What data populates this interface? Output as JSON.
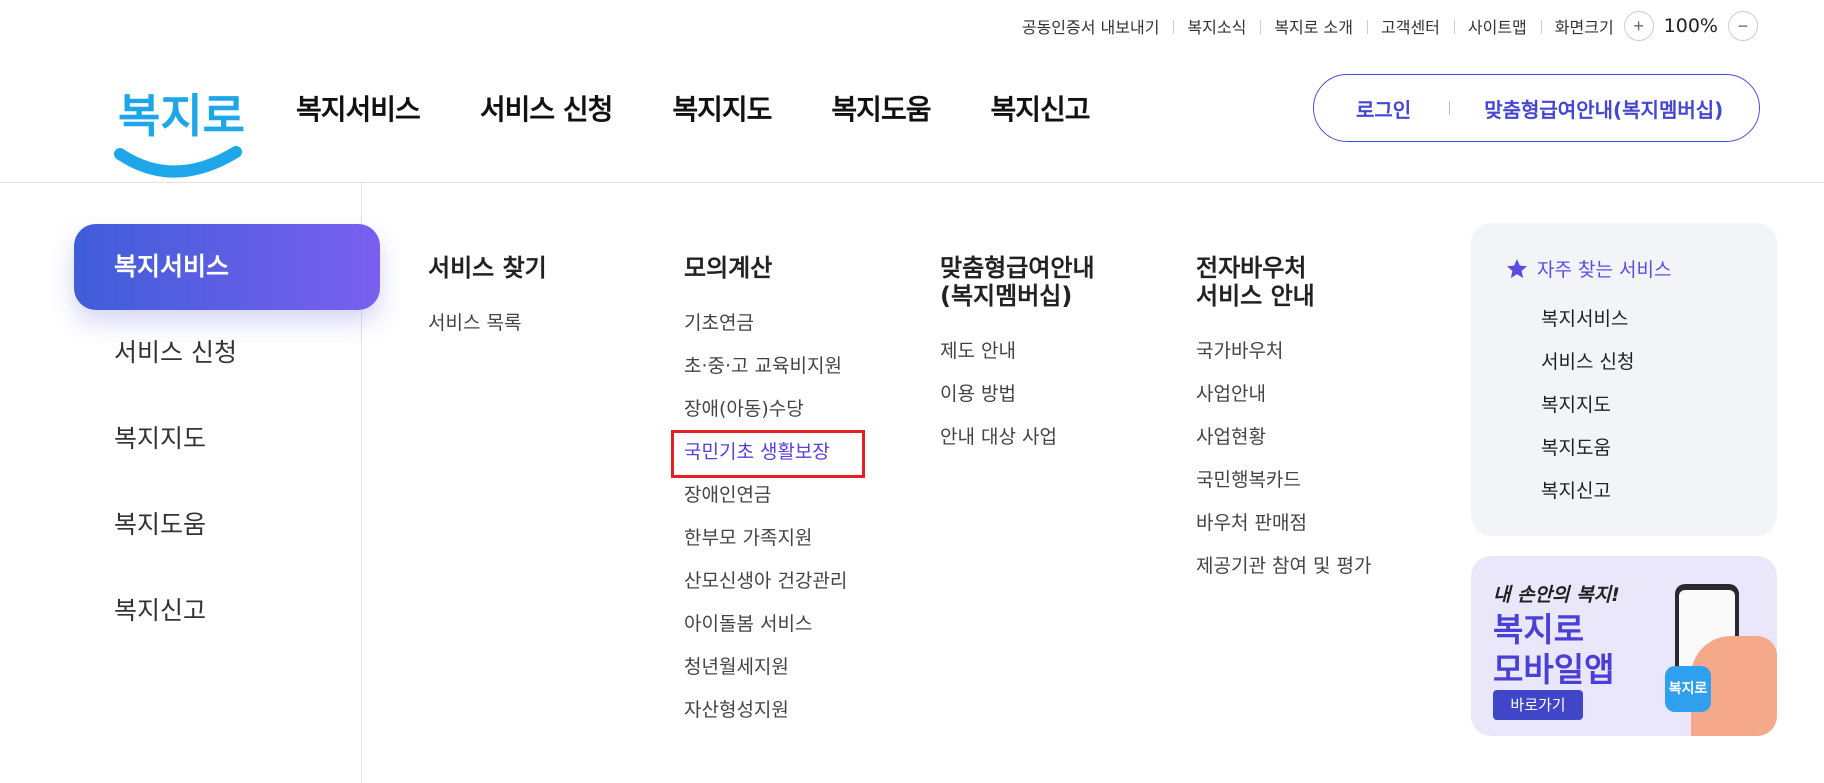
{
  "utility": {
    "links": [
      "공동인증서 내보내기",
      "복지소식",
      "복지로 소개",
      "고객센터",
      "사이트맵"
    ],
    "zoom_label": "화면크기",
    "zoom_in": "+",
    "zoom_value": "100%",
    "zoom_out": "−"
  },
  "logo": {
    "text": "복지로"
  },
  "gnb": [
    "복지서비스",
    "서비스 신청",
    "복지지도",
    "복지도움",
    "복지신고"
  ],
  "top_buttons": {
    "login": "로그인",
    "membership": "맞춤형급여안내(복지멤버십)"
  },
  "side_menu": {
    "items": [
      "복지서비스",
      "서비스 신청",
      "복지지도",
      "복지도움",
      "복지신고"
    ],
    "active_index": 0
  },
  "submenu": [
    {
      "title": "서비스 찾기",
      "items": [
        "서비스 목록"
      ]
    },
    {
      "title": "모의계산",
      "items": [
        "기초연금",
        "초·중·고 교육비지원",
        "장애(아동)수당",
        "국민기초 생활보장",
        "장애인연금",
        "한부모 가족지원",
        "산모신생아 건강관리",
        "아이돌봄 서비스",
        "청년월세지원",
        "자산형성지원"
      ],
      "highlighted_index": 3
    },
    {
      "title": "맞춤형급여안내\n(복지멤버십)",
      "items": [
        "제도 안내",
        "이용 방법",
        "안내 대상 사업"
      ]
    },
    {
      "title": "전자바우처\n서비스 안내",
      "items": [
        "국가바우처",
        "사업안내",
        "사업현황",
        "국민행복카드",
        "바우처 판매점",
        "제공기관 참여 및 평가"
      ]
    }
  ],
  "favorites": {
    "title": "자주 찾는 서비스",
    "icon": "star-icon",
    "items": [
      "복지서비스",
      "서비스 신청",
      "복지지도",
      "복지도움",
      "복지신고"
    ]
  },
  "banner": {
    "line1": "내 손안의 복지!",
    "line2": "복지로",
    "line3": "모바일앱",
    "button": "바로가기",
    "app_icon_text": "복지로"
  },
  "colors": {
    "accent": "#4447d1",
    "highlight_box": "#e41f2a",
    "favorites_bg": "#f2f4f7",
    "logo_blue": "#1ea7e8"
  }
}
